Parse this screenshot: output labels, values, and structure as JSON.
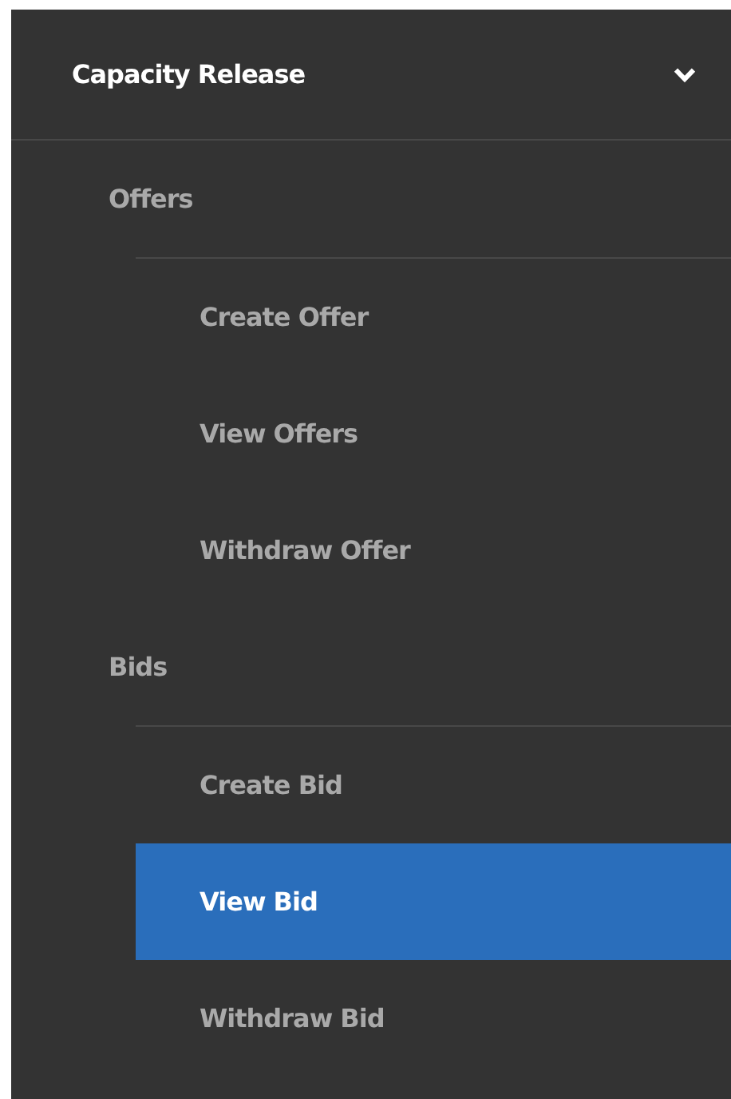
{
  "menu": {
    "title": "Capacity Release",
    "expanded": true,
    "groups": [
      {
        "label": "Offers",
        "items": [
          {
            "label": "Create Offer",
            "selected": false
          },
          {
            "label": "View Offers",
            "selected": false
          },
          {
            "label": "Withdraw Offer",
            "selected": false
          }
        ]
      },
      {
        "label": "Bids",
        "items": [
          {
            "label": "Create Bid",
            "selected": false
          },
          {
            "label": "View Bid",
            "selected": true
          },
          {
            "label": "Withdraw Bid",
            "selected": false
          }
        ]
      }
    ]
  }
}
